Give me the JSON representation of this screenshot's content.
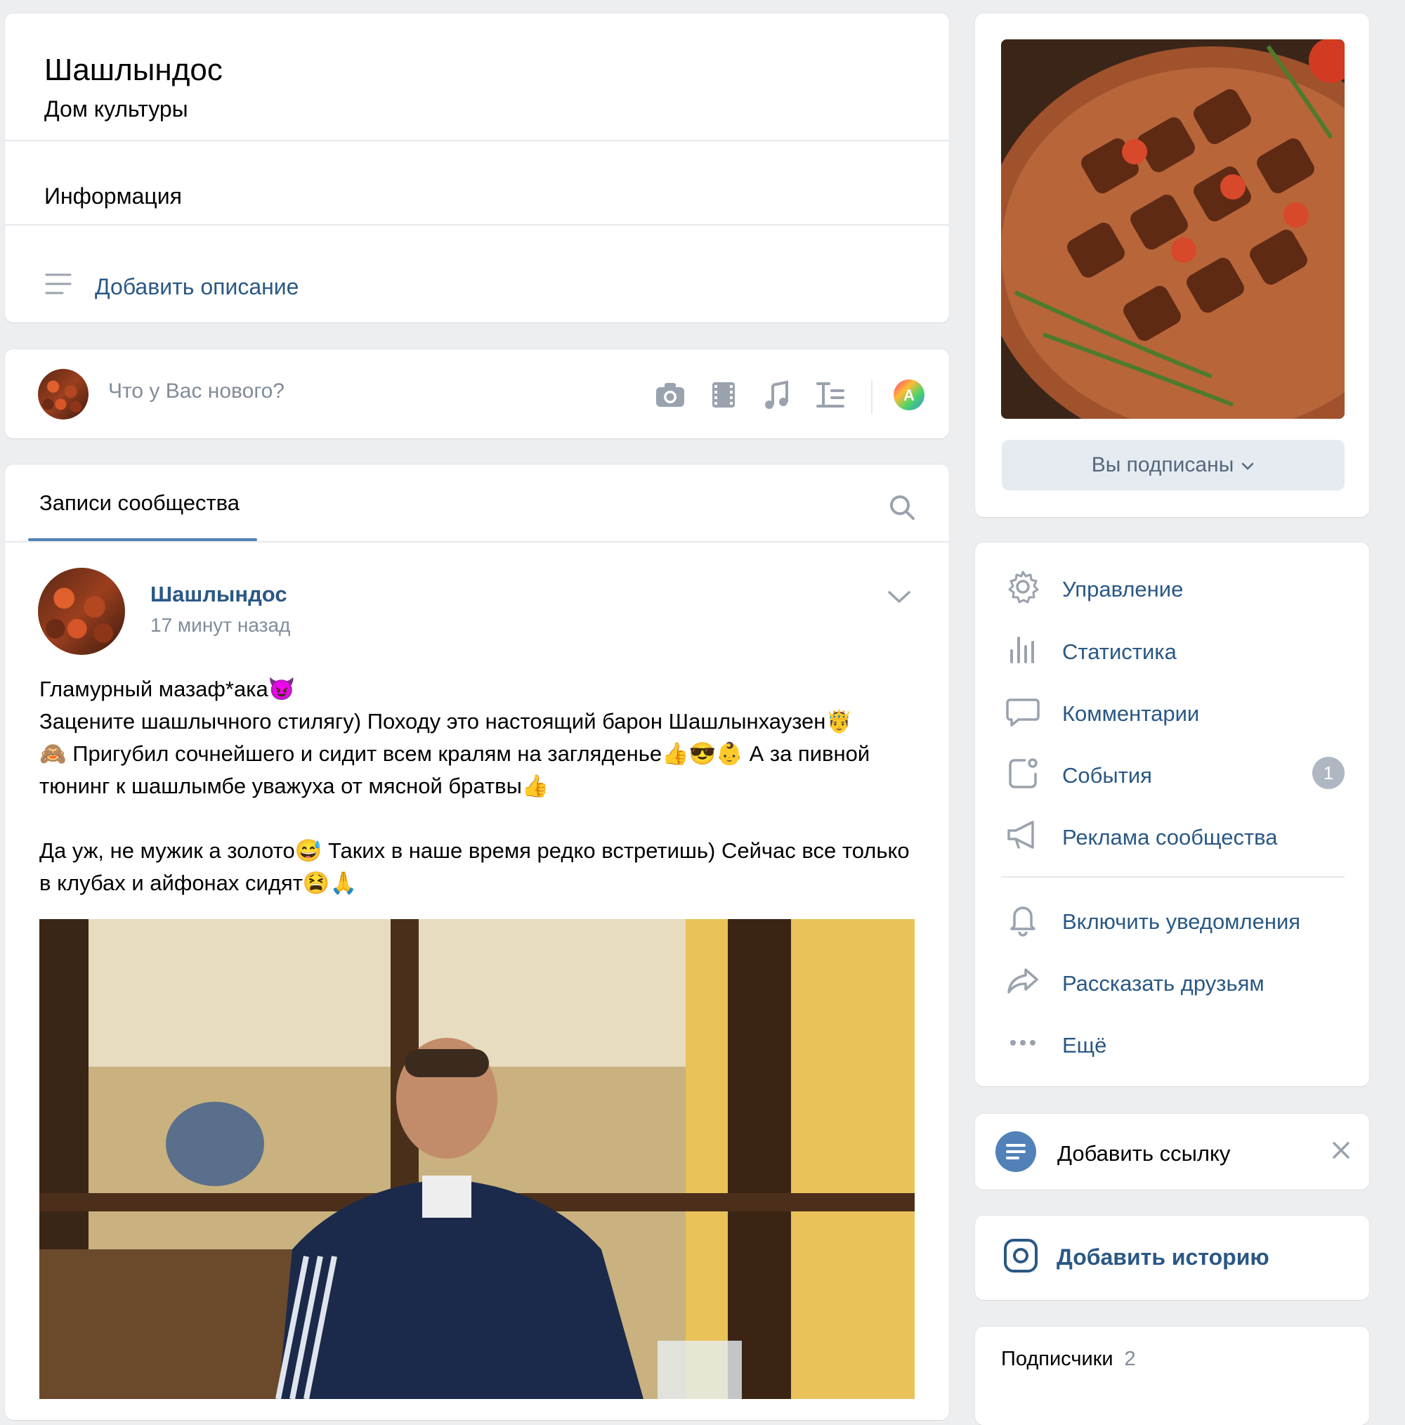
{
  "group": {
    "title": "Шашлындос",
    "subtitle": "Дом культуры",
    "info_title": "Информация",
    "add_description": "Добавить описание"
  },
  "composer": {
    "placeholder": "Что у Вас нового?"
  },
  "wall": {
    "tab_label": "Записи сообщества"
  },
  "post": {
    "author": "Шашлындос",
    "time": "17 минут назад",
    "text": "Гламурный мазаф*ака😈\nЗацените шашлычного стилягу) Походу это настоящий барон Шашлынхаузен🤴\n🙈 Пригубил сочнейшего и сидит всем кралям на загляденье👍😎👶  А за пивной тюнинг к шашлымбе уважуха от мясной братвы👍\n\nДа уж, не мужик а золото😅 Таких в наше время редко встретишь) Сейчас все только в клубах и айфонах сидят😫🙏"
  },
  "sidebar": {
    "subscribe_button": "Вы подписаны",
    "menu": [
      {
        "label": "Управление",
        "icon": "gear-icon"
      },
      {
        "label": "Статистика",
        "icon": "stats-icon"
      },
      {
        "label": "Комментарии",
        "icon": "comment-icon"
      },
      {
        "label": "События",
        "icon": "events-icon",
        "badge": "1"
      },
      {
        "label": "Реклама сообщества",
        "icon": "megaphone-icon"
      }
    ],
    "menu2": [
      {
        "label": "Включить уведомления",
        "icon": "bell-icon"
      },
      {
        "label": "Рассказать друзьям",
        "icon": "share-icon"
      },
      {
        "label": "Ещё",
        "icon": "more-icon"
      }
    ],
    "add_link": "Добавить ссылку",
    "add_story": "Добавить историю",
    "subscribers_label": "Подписчики",
    "subscribers_count": "2"
  },
  "colors": {
    "link": "#2a5885",
    "accent": "#5181b8",
    "muted": "#818c99",
    "background": "#edeef0"
  }
}
